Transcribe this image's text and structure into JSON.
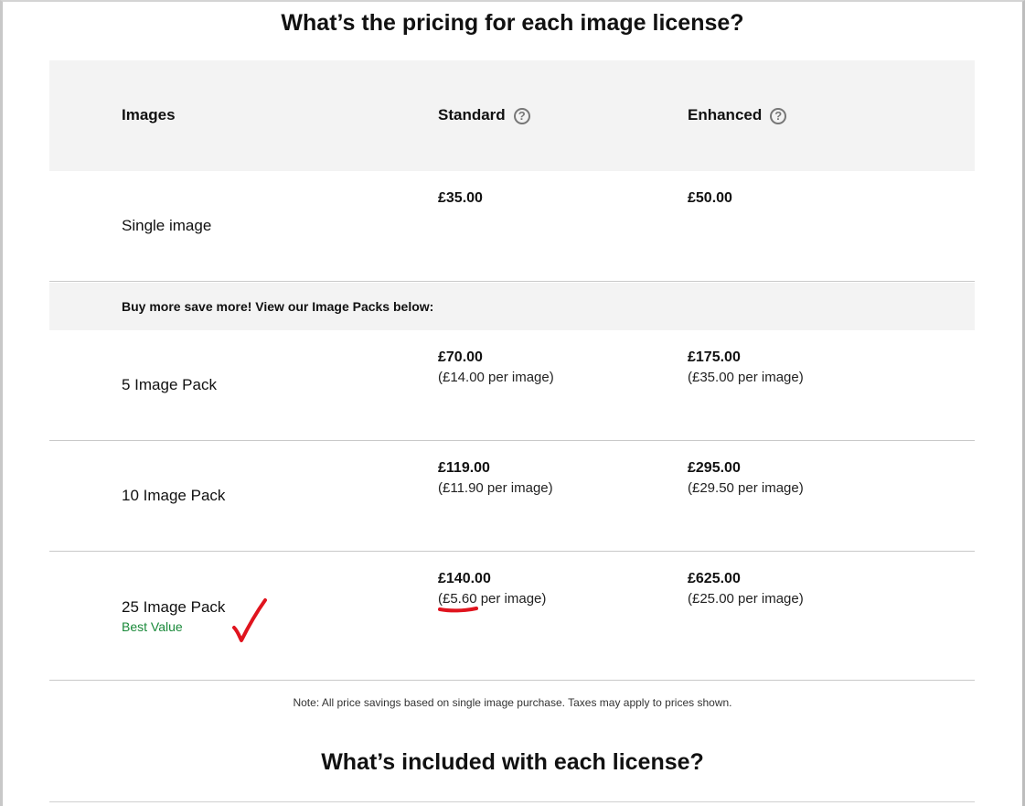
{
  "section_title": "What’s the pricing for each image license?",
  "table": {
    "headers": {
      "images": "Images",
      "standard": "Standard",
      "enhanced": "Enhanced",
      "help_glyph": "?"
    },
    "single": {
      "label": "Single image",
      "standard_price": "£35.00",
      "enhanced_price": "£50.00"
    },
    "promo": "Buy more save more! View our Image Packs below:",
    "packs": [
      {
        "label": "5 Image Pack",
        "standard_price": "£70.00",
        "standard_per": "(£14.00 per image)",
        "enhanced_price": "£175.00",
        "enhanced_per": "(£35.00 per image)"
      },
      {
        "label": "10 Image Pack",
        "standard_price": "£119.00",
        "standard_per": "(£11.90 per image)",
        "enhanced_price": "£295.00",
        "enhanced_per": "(£29.50 per image)"
      },
      {
        "label": "25 Image Pack",
        "badge": "Best Value",
        "standard_price": "£140.00",
        "standard_per": "(£5.60 per image)",
        "enhanced_price": "£625.00",
        "enhanced_per": "(£25.00 per image)"
      }
    ]
  },
  "note": "Note: All price savings based on single image purchase. Taxes may apply to prices shown.",
  "next_section_title": "What’s included with each license?",
  "colors": {
    "header_bg": "#f3f3f3",
    "best_value": "#1a8a3a",
    "annotation": "#e0141e"
  },
  "icons": {
    "help": "question-circle-icon",
    "annotation_check": "check-mark-icon",
    "annotation_underline": "underline-mark"
  }
}
